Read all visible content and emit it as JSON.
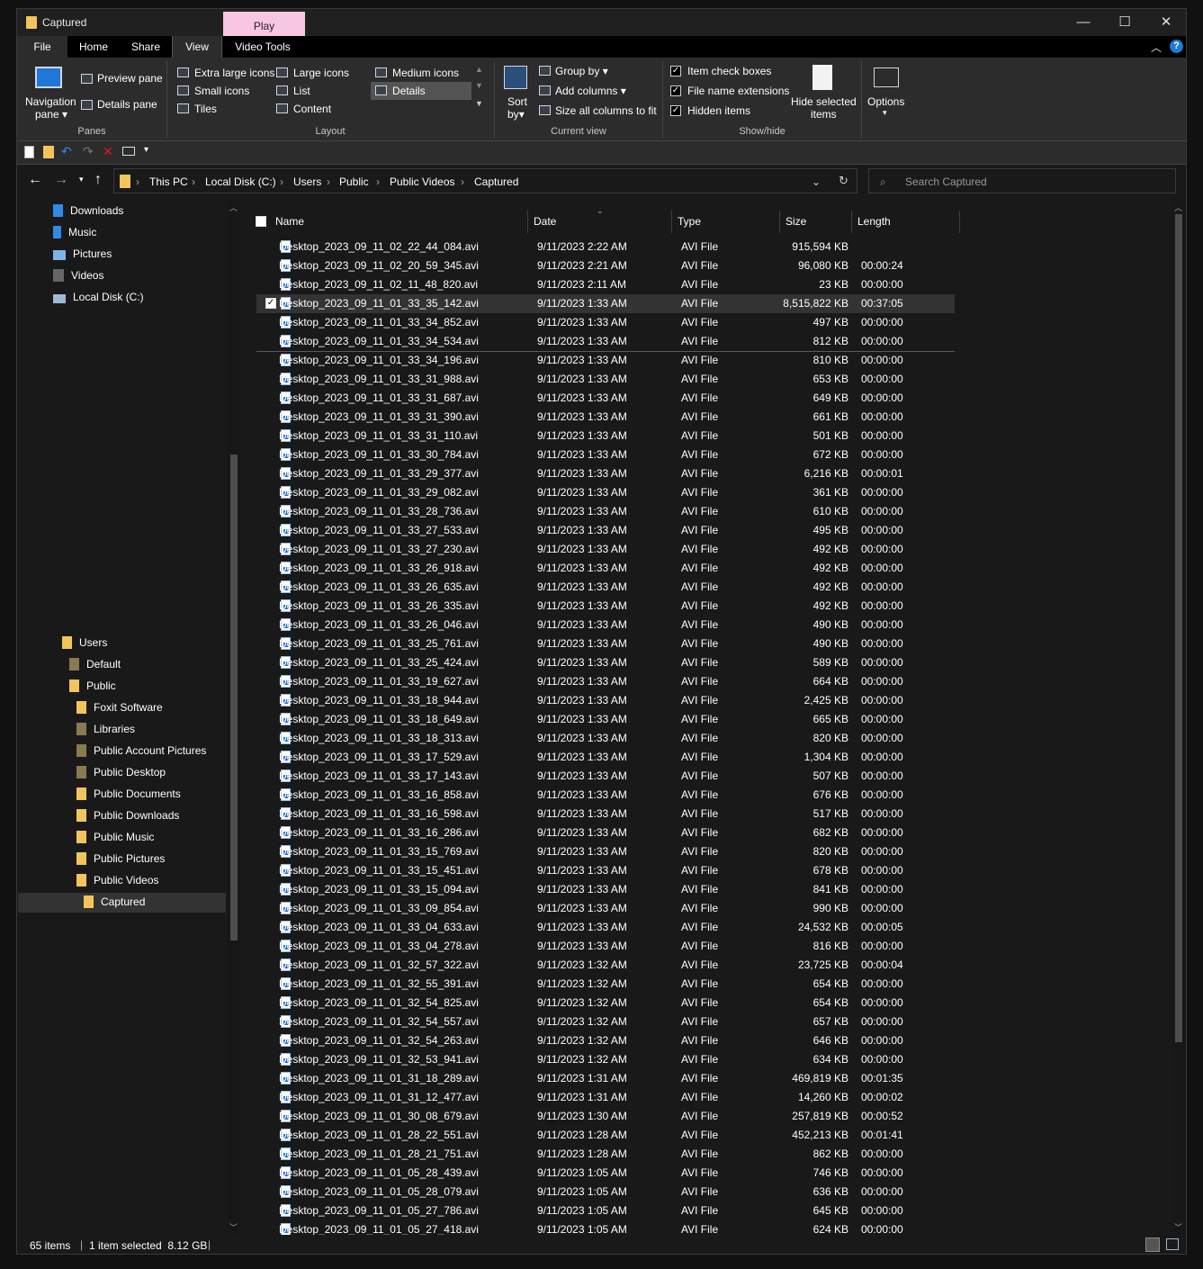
{
  "window": {
    "title": "Captured"
  },
  "context_tab": {
    "label": "Play"
  },
  "ribbon_tabs": [
    "File",
    "Home",
    "Share",
    "View",
    "Video Tools"
  ],
  "ribbon": {
    "panes": {
      "navigation_pane": "Navigation",
      "navigation_pane2": "pane",
      "preview_pane": "Preview pane",
      "details_pane": "Details pane",
      "group": "Panes"
    },
    "layout": {
      "extra_large": "Extra large icons",
      "large": "Large icons",
      "medium": "Medium icons",
      "small": "Small icons",
      "list": "List",
      "details": "Details",
      "tiles": "Tiles",
      "content": "Content",
      "group": "Layout"
    },
    "current_view": {
      "sort": "Sort",
      "sort2": "by",
      "group_by": "Group by",
      "add_columns": "Add columns",
      "size_all": "Size all columns to fit",
      "group": "Current view"
    },
    "show_hide": {
      "item_check": "Item check boxes",
      "extensions": "File name extensions",
      "hidden": "Hidden items",
      "hide_selected": "Hide selected",
      "hide_selected2": "items",
      "group": "Show/hide"
    },
    "options": "Options"
  },
  "breadcrumb": [
    "This PC",
    "Local Disk (C:)",
    "Users",
    "Public",
    "Public Videos",
    "Captured"
  ],
  "search": {
    "placeholder": "Search Captured"
  },
  "nav": {
    "quick": [
      "Downloads",
      "Music",
      "Pictures",
      "Videos",
      "Local Disk (C:)"
    ],
    "tree": [
      {
        "label": "Users",
        "level": 0
      },
      {
        "label": "Default",
        "level": 1
      },
      {
        "label": "Public",
        "level": 1
      },
      {
        "label": "Foxit Software",
        "level": 2
      },
      {
        "label": "Libraries",
        "level": 2
      },
      {
        "label": "Public Account Pictures",
        "level": 2
      },
      {
        "label": "Public Desktop",
        "level": 2
      },
      {
        "label": "Public Documents",
        "level": 2
      },
      {
        "label": "Public Downloads",
        "level": 2
      },
      {
        "label": "Public Music",
        "level": 2
      },
      {
        "label": "Public Pictures",
        "level": 2
      },
      {
        "label": "Public Videos",
        "level": 2
      },
      {
        "label": "Captured",
        "level": 3
      }
    ]
  },
  "columns": [
    "Name",
    "Date",
    "Type",
    "Size",
    "Length"
  ],
  "files": [
    [
      "Desktop_2023_09_11_02_22_44_084.avi",
      "9/11/2023 2:22 AM",
      "AVI File",
      "915,594 KB",
      ""
    ],
    [
      "Desktop_2023_09_11_02_20_59_345.avi",
      "9/11/2023 2:21 AM",
      "AVI File",
      "96,080 KB",
      "00:00:24"
    ],
    [
      "Desktop_2023_09_11_02_11_48_820.avi",
      "9/11/2023 2:11 AM",
      "AVI File",
      "23 KB",
      "00:00:00"
    ],
    [
      "Desktop_2023_09_11_01_33_35_142.avi",
      "9/11/2023 1:33 AM",
      "AVI File",
      "8,515,822 KB",
      "00:37:05"
    ],
    [
      "Desktop_2023_09_11_01_33_34_852.avi",
      "9/11/2023 1:33 AM",
      "AVI File",
      "497 KB",
      "00:00:00"
    ],
    [
      "Desktop_2023_09_11_01_33_34_534.avi",
      "9/11/2023 1:33 AM",
      "AVI File",
      "812 KB",
      "00:00:00"
    ],
    [
      "Desktop_2023_09_11_01_33_34_196.avi",
      "9/11/2023 1:33 AM",
      "AVI File",
      "810 KB",
      "00:00:00"
    ],
    [
      "Desktop_2023_09_11_01_33_31_988.avi",
      "9/11/2023 1:33 AM",
      "AVI File",
      "653 KB",
      "00:00:00"
    ],
    [
      "Desktop_2023_09_11_01_33_31_687.avi",
      "9/11/2023 1:33 AM",
      "AVI File",
      "649 KB",
      "00:00:00"
    ],
    [
      "Desktop_2023_09_11_01_33_31_390.avi",
      "9/11/2023 1:33 AM",
      "AVI File",
      "661 KB",
      "00:00:00"
    ],
    [
      "Desktop_2023_09_11_01_33_31_110.avi",
      "9/11/2023 1:33 AM",
      "AVI File",
      "501 KB",
      "00:00:00"
    ],
    [
      "Desktop_2023_09_11_01_33_30_784.avi",
      "9/11/2023 1:33 AM",
      "AVI File",
      "672 KB",
      "00:00:00"
    ],
    [
      "Desktop_2023_09_11_01_33_29_377.avi",
      "9/11/2023 1:33 AM",
      "AVI File",
      "6,216 KB",
      "00:00:01"
    ],
    [
      "Desktop_2023_09_11_01_33_29_082.avi",
      "9/11/2023 1:33 AM",
      "AVI File",
      "361 KB",
      "00:00:00"
    ],
    [
      "Desktop_2023_09_11_01_33_28_736.avi",
      "9/11/2023 1:33 AM",
      "AVI File",
      "610 KB",
      "00:00:00"
    ],
    [
      "Desktop_2023_09_11_01_33_27_533.avi",
      "9/11/2023 1:33 AM",
      "AVI File",
      "495 KB",
      "00:00:00"
    ],
    [
      "Desktop_2023_09_11_01_33_27_230.avi",
      "9/11/2023 1:33 AM",
      "AVI File",
      "492 KB",
      "00:00:00"
    ],
    [
      "Desktop_2023_09_11_01_33_26_918.avi",
      "9/11/2023 1:33 AM",
      "AVI File",
      "492 KB",
      "00:00:00"
    ],
    [
      "Desktop_2023_09_11_01_33_26_635.avi",
      "9/11/2023 1:33 AM",
      "AVI File",
      "492 KB",
      "00:00:00"
    ],
    [
      "Desktop_2023_09_11_01_33_26_335.avi",
      "9/11/2023 1:33 AM",
      "AVI File",
      "492 KB",
      "00:00:00"
    ],
    [
      "Desktop_2023_09_11_01_33_26_046.avi",
      "9/11/2023 1:33 AM",
      "AVI File",
      "490 KB",
      "00:00:00"
    ],
    [
      "Desktop_2023_09_11_01_33_25_761.avi",
      "9/11/2023 1:33 AM",
      "AVI File",
      "490 KB",
      "00:00:00"
    ],
    [
      "Desktop_2023_09_11_01_33_25_424.avi",
      "9/11/2023 1:33 AM",
      "AVI File",
      "589 KB",
      "00:00:00"
    ],
    [
      "Desktop_2023_09_11_01_33_19_627.avi",
      "9/11/2023 1:33 AM",
      "AVI File",
      "664 KB",
      "00:00:00"
    ],
    [
      "Desktop_2023_09_11_01_33_18_944.avi",
      "9/11/2023 1:33 AM",
      "AVI File",
      "2,425 KB",
      "00:00:00"
    ],
    [
      "Desktop_2023_09_11_01_33_18_649.avi",
      "9/11/2023 1:33 AM",
      "AVI File",
      "665 KB",
      "00:00:00"
    ],
    [
      "Desktop_2023_09_11_01_33_18_313.avi",
      "9/11/2023 1:33 AM",
      "AVI File",
      "820 KB",
      "00:00:00"
    ],
    [
      "Desktop_2023_09_11_01_33_17_529.avi",
      "9/11/2023 1:33 AM",
      "AVI File",
      "1,304 KB",
      "00:00:00"
    ],
    [
      "Desktop_2023_09_11_01_33_17_143.avi",
      "9/11/2023 1:33 AM",
      "AVI File",
      "507 KB",
      "00:00:00"
    ],
    [
      "Desktop_2023_09_11_01_33_16_858.avi",
      "9/11/2023 1:33 AM",
      "AVI File",
      "676 KB",
      "00:00:00"
    ],
    [
      "Desktop_2023_09_11_01_33_16_598.avi",
      "9/11/2023 1:33 AM",
      "AVI File",
      "517 KB",
      "00:00:00"
    ],
    [
      "Desktop_2023_09_11_01_33_16_286.avi",
      "9/11/2023 1:33 AM",
      "AVI File",
      "682 KB",
      "00:00:00"
    ],
    [
      "Desktop_2023_09_11_01_33_15_769.avi",
      "9/11/2023 1:33 AM",
      "AVI File",
      "820 KB",
      "00:00:00"
    ],
    [
      "Desktop_2023_09_11_01_33_15_451.avi",
      "9/11/2023 1:33 AM",
      "AVI File",
      "678 KB",
      "00:00:00"
    ],
    [
      "Desktop_2023_09_11_01_33_15_094.avi",
      "9/11/2023 1:33 AM",
      "AVI File",
      "841 KB",
      "00:00:00"
    ],
    [
      "Desktop_2023_09_11_01_33_09_854.avi",
      "9/11/2023 1:33 AM",
      "AVI File",
      "990 KB",
      "00:00:00"
    ],
    [
      "Desktop_2023_09_11_01_33_04_633.avi",
      "9/11/2023 1:33 AM",
      "AVI File",
      "24,532 KB",
      "00:00:05"
    ],
    [
      "Desktop_2023_09_11_01_33_04_278.avi",
      "9/11/2023 1:33 AM",
      "AVI File",
      "816 KB",
      "00:00:00"
    ],
    [
      "Desktop_2023_09_11_01_32_57_322.avi",
      "9/11/2023 1:32 AM",
      "AVI File",
      "23,725 KB",
      "00:00:04"
    ],
    [
      "Desktop_2023_09_11_01_32_55_391.avi",
      "9/11/2023 1:32 AM",
      "AVI File",
      "654 KB",
      "00:00:00"
    ],
    [
      "Desktop_2023_09_11_01_32_54_825.avi",
      "9/11/2023 1:32 AM",
      "AVI File",
      "654 KB",
      "00:00:00"
    ],
    [
      "Desktop_2023_09_11_01_32_54_557.avi",
      "9/11/2023 1:32 AM",
      "AVI File",
      "657 KB",
      "00:00:00"
    ],
    [
      "Desktop_2023_09_11_01_32_54_263.avi",
      "9/11/2023 1:32 AM",
      "AVI File",
      "646 KB",
      "00:00:00"
    ],
    [
      "Desktop_2023_09_11_01_32_53_941.avi",
      "9/11/2023 1:32 AM",
      "AVI File",
      "634 KB",
      "00:00:00"
    ],
    [
      "Desktop_2023_09_11_01_31_18_289.avi",
      "9/11/2023 1:31 AM",
      "AVI File",
      "469,819 KB",
      "00:01:35"
    ],
    [
      "Desktop_2023_09_11_01_31_12_477.avi",
      "9/11/2023 1:31 AM",
      "AVI File",
      "14,260 KB",
      "00:00:02"
    ],
    [
      "Desktop_2023_09_11_01_30_08_679.avi",
      "9/11/2023 1:30 AM",
      "AVI File",
      "257,819 KB",
      "00:00:52"
    ],
    [
      "Desktop_2023_09_11_01_28_22_551.avi",
      "9/11/2023 1:28 AM",
      "AVI File",
      "452,213 KB",
      "00:01:41"
    ],
    [
      "Desktop_2023_09_11_01_28_21_751.avi",
      "9/11/2023 1:28 AM",
      "AVI File",
      "862 KB",
      "00:00:00"
    ],
    [
      "Desktop_2023_09_11_01_05_28_439.avi",
      "9/11/2023 1:05 AM",
      "AVI File",
      "746 KB",
      "00:00:00"
    ],
    [
      "Desktop_2023_09_11_01_05_28_079.avi",
      "9/11/2023 1:05 AM",
      "AVI File",
      "636 KB",
      "00:00:00"
    ],
    [
      "Desktop_2023_09_11_01_05_27_786.avi",
      "9/11/2023 1:05 AM",
      "AVI File",
      "645 KB",
      "00:00:00"
    ],
    [
      "Desktop_2023_09_11_01_05_27_418.avi",
      "9/11/2023 1:05 AM",
      "AVI File",
      "624 KB",
      "00:00:00"
    ]
  ],
  "selected_index": 3,
  "status": {
    "count": "65 items",
    "selection": "1 item selected  8.12 GB"
  },
  "colors": {
    "background": "#191919",
    "accent": "#1e78d7",
    "folder": "#f2c55c",
    "context_tab": "#f7c6e3",
    "selection": "#333333"
  }
}
